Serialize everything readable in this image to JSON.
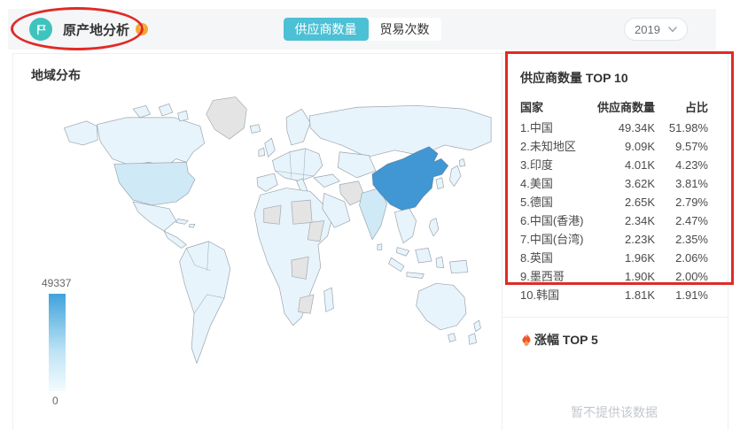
{
  "header": {
    "title": "原产地分析",
    "help_label": "?",
    "tabs": [
      {
        "label": "供应商数量"
      },
      {
        "label": "贸易次数"
      }
    ],
    "active_tab": "供应商数量",
    "year": "2019"
  },
  "map": {
    "title": "地域分布",
    "legend": {
      "max": "49337",
      "min": "0"
    },
    "highlight_country": "中国",
    "colors": {
      "highlight": "#4197d3",
      "base": "#e8f4fc",
      "shaded": "#cfe9f7",
      "unknown": "#e4e4e4"
    }
  },
  "top10": {
    "title": "供应商数量 TOP 10",
    "columns": [
      "国家",
      "供应商数量",
      "占比"
    ],
    "rows": [
      {
        "country": "1.中国",
        "value": "49.34K",
        "share": "51.98%"
      },
      {
        "country": "2.未知地区",
        "value": "9.09K",
        "share": "9.57%"
      },
      {
        "country": "3.印度",
        "value": "4.01K",
        "share": "4.23%"
      },
      {
        "country": "4.美国",
        "value": "3.62K",
        "share": "3.81%"
      },
      {
        "country": "5.德国",
        "value": "2.65K",
        "share": "2.79%"
      },
      {
        "country": "6.中国(香港)",
        "value": "2.34K",
        "share": "2.47%"
      },
      {
        "country": "7.中国(台湾)",
        "value": "2.23K",
        "share": "2.35%"
      },
      {
        "country": "8.英国",
        "value": "1.96K",
        "share": "2.06%"
      },
      {
        "country": "9.墨西哥",
        "value": "1.90K",
        "share": "2.00%"
      },
      {
        "country": "10.韩国",
        "value": "1.81K",
        "share": "1.91%"
      }
    ]
  },
  "rise": {
    "title": "涨幅 TOP 5",
    "empty_text": "暂不提供该数据"
  },
  "chart_data": {
    "type": "heatmap",
    "subtype": "world-choropleth",
    "title": "地域分布",
    "value_range": [
      0,
      49337
    ],
    "legend_position": "bottom-left",
    "categories": [
      "中国",
      "未知地区",
      "印度",
      "美国",
      "德国",
      "中国(香港)",
      "中国(台湾)",
      "英国",
      "墨西哥",
      "韩国"
    ],
    "values": [
      49337,
      9090,
      4010,
      3620,
      2650,
      2340,
      2230,
      1960,
      1900,
      1810
    ],
    "shares_pct": [
      51.98,
      9.57,
      4.23,
      3.81,
      2.79,
      2.47,
      2.35,
      2.06,
      2.0,
      1.91
    ]
  }
}
